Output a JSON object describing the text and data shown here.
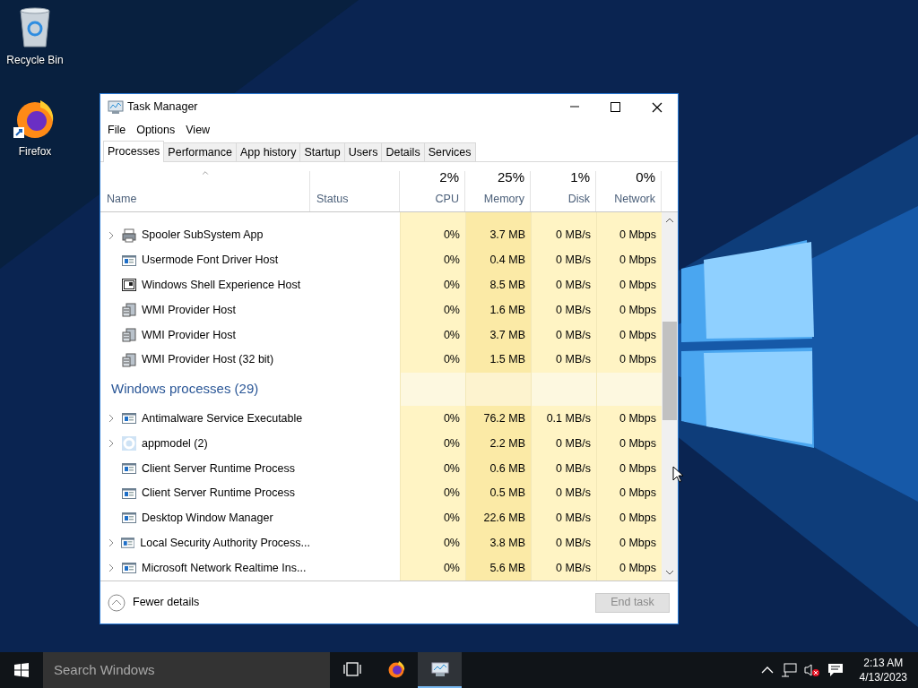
{
  "desktop_icons": [
    {
      "label": "Recycle Bin",
      "kind": "recycle"
    },
    {
      "label": "Firefox",
      "kind": "firefox"
    }
  ],
  "window": {
    "title": "Task Manager",
    "menu": [
      "File",
      "Options",
      "View"
    ],
    "tabs": [
      {
        "label": "Processes",
        "selected": true
      },
      {
        "label": "Performance",
        "selected": false
      },
      {
        "label": "App history",
        "selected": false
      },
      {
        "label": "Startup",
        "selected": false
      },
      {
        "label": "Users",
        "selected": false
      },
      {
        "label": "Details",
        "selected": false
      },
      {
        "label": "Services",
        "selected": false
      }
    ],
    "columns": [
      {
        "label": "Name",
        "sorted": true
      },
      {
        "label": "Status"
      },
      {
        "label": "CPU",
        "total": "2%"
      },
      {
        "label": "Memory",
        "total": "25%"
      },
      {
        "label": "Disk",
        "total": "1%"
      },
      {
        "label": "Network",
        "total": "0%"
      }
    ],
    "rows": [
      {
        "kind": "printer",
        "name": "Spooler SubSystem App",
        "expandable": true,
        "cpu": "0%",
        "memory": "3.7 MB",
        "disk": "0 MB/s",
        "network": "0 Mbps"
      },
      {
        "kind": "window",
        "name": "Usermode Font Driver Host",
        "expandable": false,
        "cpu": "0%",
        "memory": "0.4 MB",
        "disk": "0 MB/s",
        "network": "0 Mbps"
      },
      {
        "kind": "shell",
        "name": "Windows Shell Experience Host",
        "expandable": false,
        "cpu": "0%",
        "memory": "8.5 MB",
        "disk": "0 MB/s",
        "network": "0 Mbps"
      },
      {
        "kind": "server",
        "name": "WMI Provider Host",
        "expandable": false,
        "cpu": "0%",
        "memory": "1.6 MB",
        "disk": "0 MB/s",
        "network": "0 Mbps"
      },
      {
        "kind": "server",
        "name": "WMI Provider Host",
        "expandable": false,
        "cpu": "0%",
        "memory": "3.7 MB",
        "disk": "0 MB/s",
        "network": "0 Mbps"
      },
      {
        "kind": "server",
        "name": "WMI Provider Host (32 bit)",
        "expandable": false,
        "cpu": "0%",
        "memory": "1.5 MB",
        "disk": "0 MB/s",
        "network": "0 Mbps"
      },
      {
        "kind": "group",
        "name": "Windows processes (29)"
      },
      {
        "kind": "window",
        "name": "Antimalware Service Executable",
        "expandable": true,
        "cpu": "0%",
        "memory": "76.2 MB",
        "disk": "0.1 MB/s",
        "network": "0 Mbps"
      },
      {
        "kind": "gear",
        "name": "appmodel (2)",
        "expandable": true,
        "cpu": "0%",
        "memory": "2.2 MB",
        "disk": "0 MB/s",
        "network": "0 Mbps"
      },
      {
        "kind": "window",
        "name": "Client Server Runtime Process",
        "expandable": false,
        "cpu": "0%",
        "memory": "0.6 MB",
        "disk": "0 MB/s",
        "network": "0 Mbps"
      },
      {
        "kind": "window",
        "name": "Client Server Runtime Process",
        "expandable": false,
        "cpu": "0%",
        "memory": "0.5 MB",
        "disk": "0 MB/s",
        "network": "0 Mbps"
      },
      {
        "kind": "window",
        "name": "Desktop Window Manager",
        "expandable": false,
        "cpu": "0%",
        "memory": "22.6 MB",
        "disk": "0 MB/s",
        "network": "0 Mbps"
      },
      {
        "kind": "window",
        "name": "Local Security Authority Process...",
        "expandable": true,
        "cpu": "0%",
        "memory": "3.8 MB",
        "disk": "0 MB/s",
        "network": "0 Mbps"
      },
      {
        "kind": "window",
        "name": "Microsoft Network Realtime Ins...",
        "expandable": true,
        "cpu": "0%",
        "memory": "5.6 MB",
        "disk": "0 MB/s",
        "network": "0 Mbps"
      }
    ],
    "footer": {
      "toggle": "Fewer details",
      "end_task": {
        "label": "End task",
        "disabled": true
      }
    }
  },
  "taskbar": {
    "search": {
      "placeholder": "Search Windows"
    },
    "apps": [
      {
        "kind": "taskview",
        "selected": false
      },
      {
        "kind": "firefox",
        "selected": false
      },
      {
        "kind": "taskmgr",
        "selected": true
      }
    ],
    "time": "2:13 AM",
    "date": "4/13/2023"
  }
}
